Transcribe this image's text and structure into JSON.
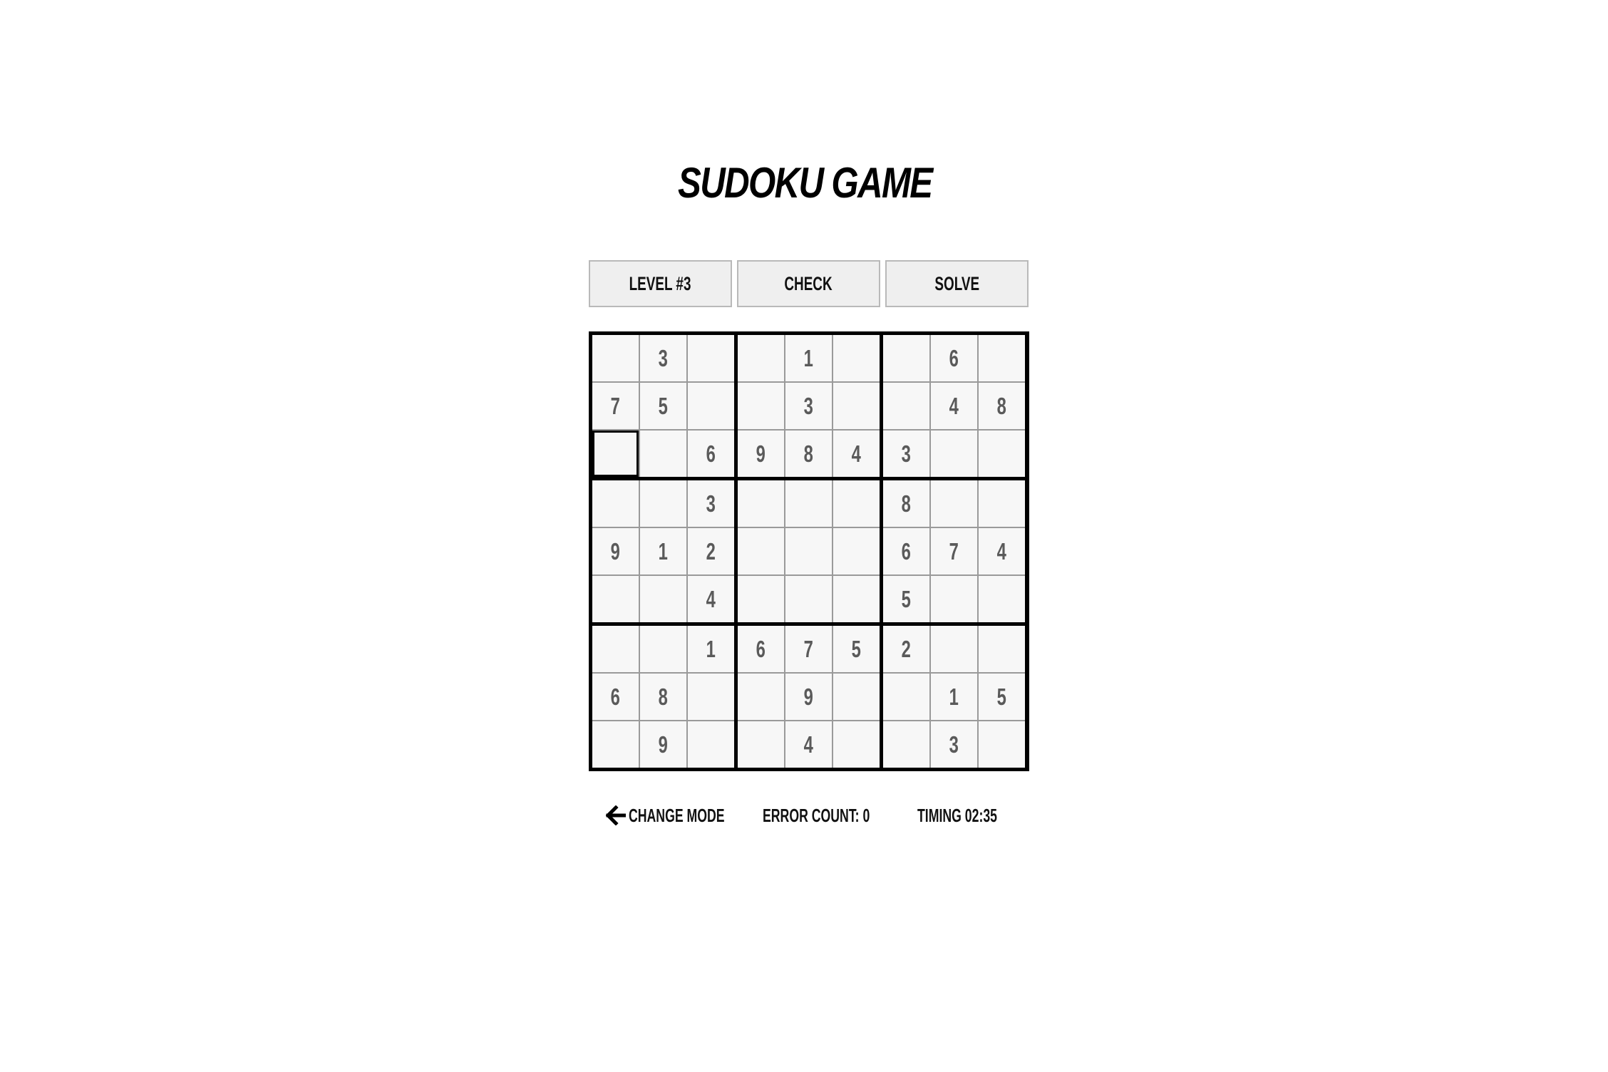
{
  "title": "SUDOKU GAME",
  "controls": {
    "level": "LEVEL #3",
    "check": "CHECK",
    "solve": "SOLVE"
  },
  "board": {
    "cells": [
      [
        "",
        "3",
        "",
        "",
        "1",
        "",
        "",
        "6",
        ""
      ],
      [
        "7",
        "5",
        "",
        "",
        "3",
        "",
        "",
        "4",
        "8"
      ],
      [
        "",
        "",
        "6",
        "9",
        "8",
        "4",
        "3",
        "",
        ""
      ],
      [
        "",
        "",
        "3",
        "",
        "",
        "",
        "8",
        "",
        ""
      ],
      [
        "9",
        "1",
        "2",
        "",
        "",
        "",
        "6",
        "7",
        "4"
      ],
      [
        "",
        "",
        "4",
        "",
        "",
        "",
        "5",
        "",
        ""
      ],
      [
        "",
        "",
        "1",
        "6",
        "7",
        "5",
        "2",
        "",
        ""
      ],
      [
        "6",
        "8",
        "",
        "",
        "9",
        "",
        "",
        "1",
        "5"
      ],
      [
        "",
        "9",
        "",
        "",
        "4",
        "",
        "",
        "3",
        ""
      ]
    ],
    "selected": {
      "row": 2,
      "col": 0
    }
  },
  "footer": {
    "change_mode": "CHANGE MODE",
    "error_count": "ERROR COUNT: 0",
    "timing": "TIMING 02:35"
  },
  "icons": {
    "back": "arrow-left-icon"
  }
}
